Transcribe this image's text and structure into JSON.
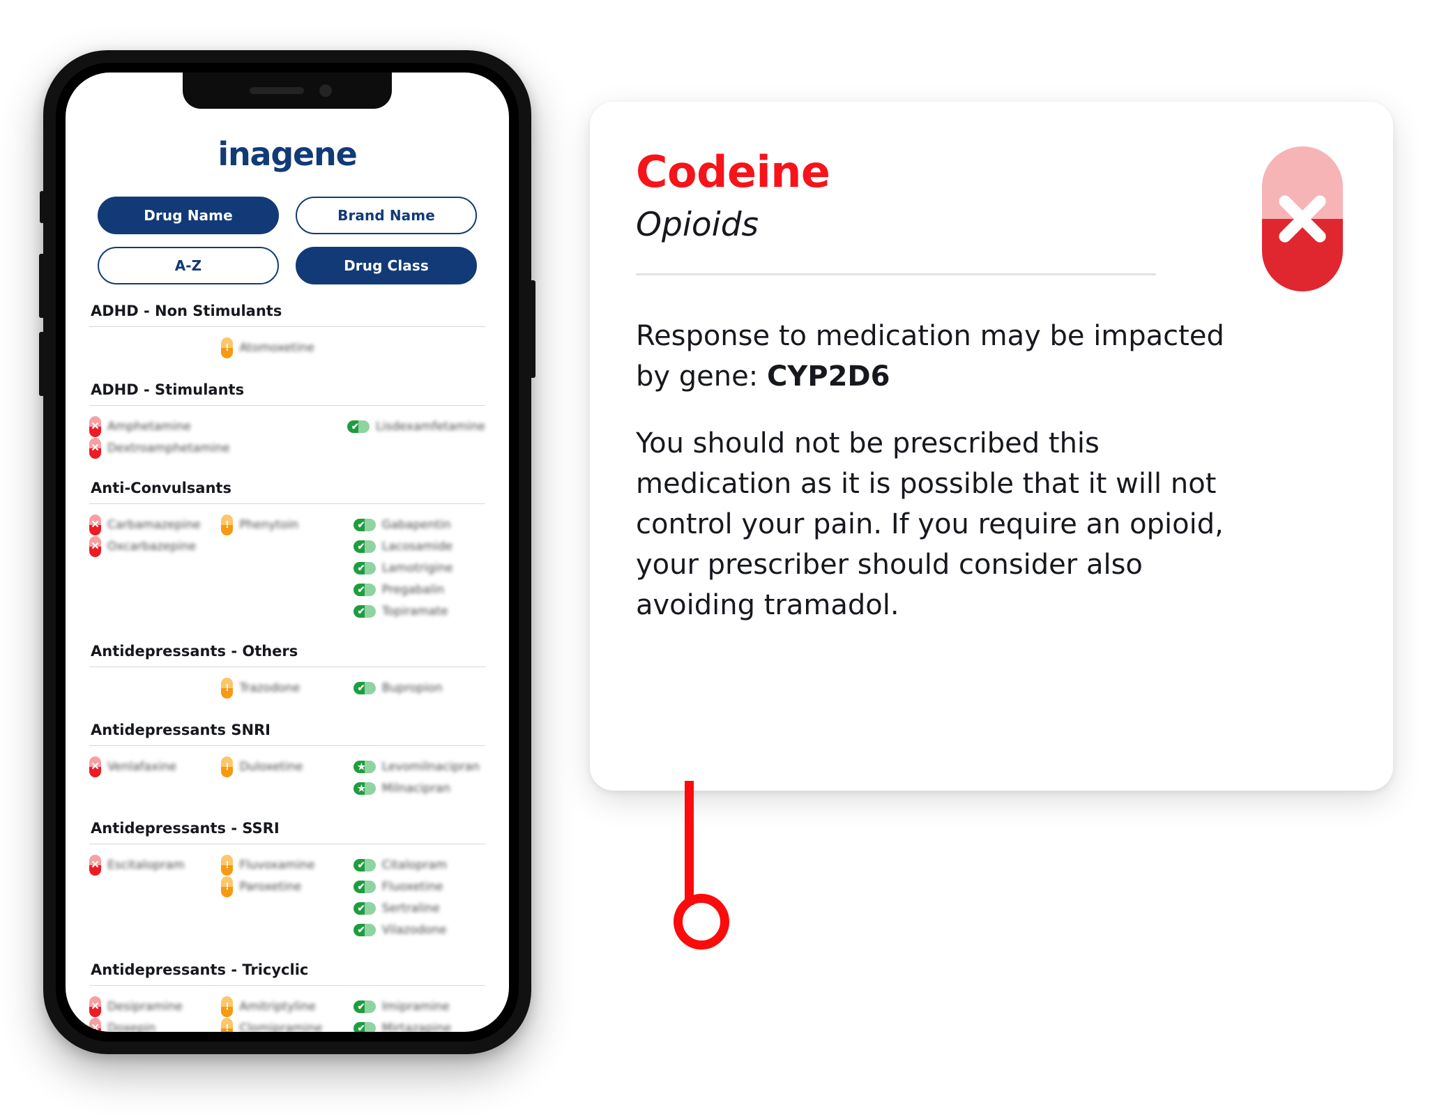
{
  "app": {
    "logo": "inagene",
    "filters": [
      {
        "label": "Drug Name",
        "style": "solid"
      },
      {
        "label": "Brand Name",
        "style": "hollow"
      },
      {
        "label": "A-Z",
        "style": "hollow"
      },
      {
        "label": "Drug Class",
        "style": "solid"
      }
    ],
    "sections": [
      {
        "title": "ADHD - Non Stimulants",
        "columns": [
          {
            "drugs": []
          },
          {
            "drugs": [
              {
                "name": "Atomoxetine",
                "icon": "amber-caution-pill-icon"
              }
            ]
          },
          {
            "drugs": []
          }
        ]
      },
      {
        "title": "ADHD - Stimulants",
        "columns": [
          {
            "drugs": [
              {
                "name": "Amphetamine",
                "icon": "red-x-pill-icon"
              },
              {
                "name": "Dextroamphetamine",
                "icon": "red-x-pill-icon"
              }
            ]
          },
          {
            "drugs": []
          },
          {
            "drugs": [
              {
                "name": "Lisdexamfetamine",
                "icon": "green-check-pill-icon"
              }
            ]
          }
        ]
      },
      {
        "title": "Anti-Convulsants",
        "columns": [
          {
            "drugs": [
              {
                "name": "Carbamazepine",
                "icon": "red-x-pill-icon"
              },
              {
                "name": "Oxcarbazepine",
                "icon": "red-x-pill-icon"
              }
            ]
          },
          {
            "drugs": [
              {
                "name": "Phenytoin",
                "icon": "amber-caution-pill-icon"
              }
            ]
          },
          {
            "drugs": [
              {
                "name": "Gabapentin",
                "icon": "green-check-pill-icon"
              },
              {
                "name": "Lacosamide",
                "icon": "green-check-pill-icon"
              },
              {
                "name": "Lamotrigine",
                "icon": "green-check-pill-icon"
              },
              {
                "name": "Pregabalin",
                "icon": "green-check-pill-icon"
              },
              {
                "name": "Topiramate",
                "icon": "green-check-pill-icon"
              }
            ]
          }
        ]
      },
      {
        "title": "Antidepressants - Others",
        "columns": [
          {
            "drugs": []
          },
          {
            "drugs": [
              {
                "name": "Trazodone",
                "icon": "amber-caution-pill-icon"
              }
            ]
          },
          {
            "drugs": [
              {
                "name": "Bupropion",
                "icon": "green-check-pill-icon"
              }
            ]
          }
        ]
      },
      {
        "title": "Antidepressants SNRI",
        "columns": [
          {
            "drugs": [
              {
                "name": "Venlafaxine",
                "icon": "red-x-pill-icon"
              }
            ]
          },
          {
            "drugs": [
              {
                "name": "Duloxetine",
                "icon": "amber-caution-pill-icon"
              }
            ]
          },
          {
            "drugs": [
              {
                "name": "Levomilnacipran",
                "icon": "green-star-pill-icon"
              },
              {
                "name": "Milnacipran",
                "icon": "green-star-pill-icon"
              }
            ]
          }
        ]
      },
      {
        "title": "Antidepressants - SSRI",
        "columns": [
          {
            "drugs": [
              {
                "name": "Escitalopram",
                "icon": "red-x-pill-icon"
              }
            ]
          },
          {
            "drugs": [
              {
                "name": "Fluvoxamine",
                "icon": "amber-caution-pill-icon"
              },
              {
                "name": "Paroxetine",
                "icon": "amber-caution-pill-icon"
              }
            ]
          },
          {
            "drugs": [
              {
                "name": "Citalopram",
                "icon": "green-check-pill-icon"
              },
              {
                "name": "Fluoxetine",
                "icon": "green-check-pill-icon"
              },
              {
                "name": "Sertraline",
                "icon": "green-check-pill-icon"
              },
              {
                "name": "Vilazodone",
                "icon": "green-check-pill-icon"
              }
            ]
          }
        ]
      },
      {
        "title": "Antidepressants - Tricyclic",
        "columns": [
          {
            "drugs": [
              {
                "name": "Desipramine",
                "icon": "red-x-pill-icon"
              },
              {
                "name": "Doxepin",
                "icon": "red-x-pill-icon"
              }
            ]
          },
          {
            "drugs": [
              {
                "name": "Amitriptyline",
                "icon": "amber-caution-pill-icon"
              },
              {
                "name": "Clomipramine",
                "icon": "amber-caution-pill-icon"
              }
            ]
          },
          {
            "drugs": [
              {
                "name": "Imipramine",
                "icon": "green-check-pill-icon"
              },
              {
                "name": "Mirtazapine",
                "icon": "green-check-pill-icon"
              }
            ]
          }
        ]
      }
    ]
  },
  "card": {
    "drug_name": "Codeine",
    "drug_class": "Opioids",
    "status_icon": "red-x-capsule-icon",
    "paragraph_1_prefix": "Response to medication may be impacted by gene: ",
    "gene": "CYP2D6",
    "paragraph_2": "You should not be prescribed this medication as it is possible that it will not control your pain. If you require an opioid, your prescriber should consider also avoiding tramadol."
  },
  "colors": {
    "brand_navy": "#123a76",
    "alert_red": "#f6131a",
    "pointer_red": "#fb0b0b",
    "pill_red": "#ee1b24",
    "pill_amber": "#f59a12",
    "pill_green": "#1e9d3f"
  }
}
